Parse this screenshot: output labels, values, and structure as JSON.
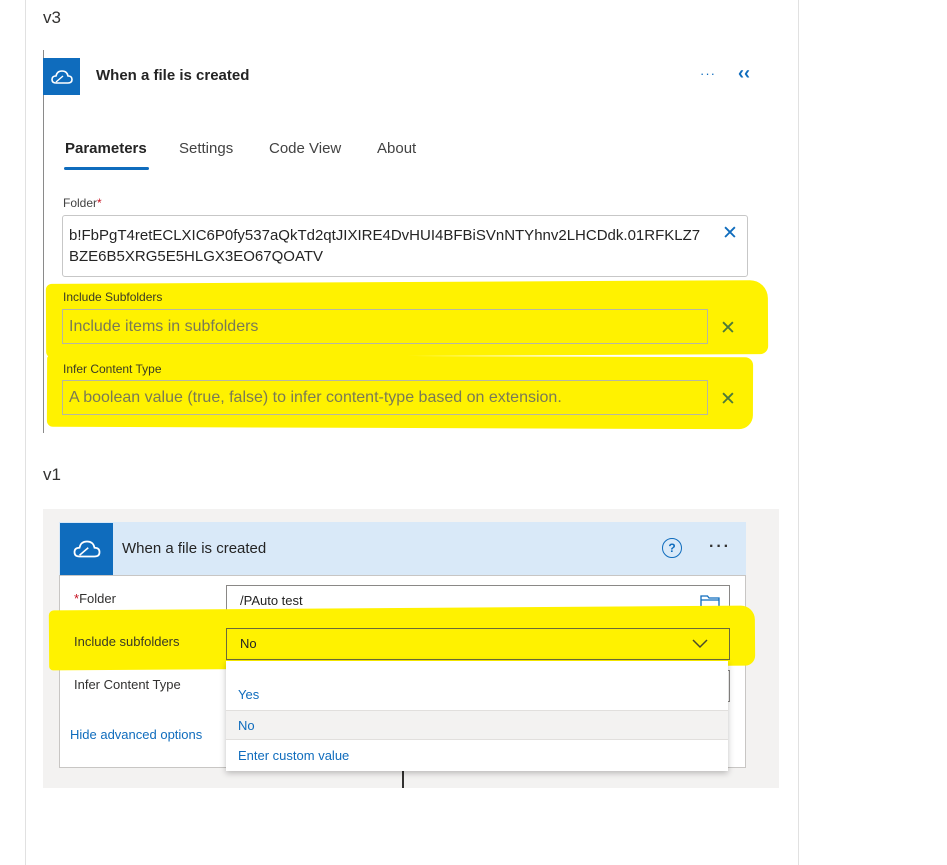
{
  "v3": {
    "section_label": "v3",
    "header": {
      "title": "When a file is created",
      "more": "···",
      "collapse": "‹‹",
      "icon": "cloud-icon"
    },
    "tabs": [
      "Parameters",
      "Settings",
      "Code View",
      "About"
    ],
    "folder": {
      "label": "Folder",
      "required_mark": "*",
      "value": "b!FbPgT4retECLXIC6P0fy537aQkTd2qtJIXIRE4DvHUI4BFBiSVnNTYhnv2LHCDdk.01RFKLZ7BZE6B5XRG5E5HLGX3EO67QOATV",
      "clear": "✕"
    },
    "include_subfolders": {
      "label": "Include Subfolders",
      "placeholder": "Include items in subfolders",
      "clear": "✕"
    },
    "infer_content_type": {
      "label": "Infer Content Type",
      "placeholder": "A boolean value (true, false) to infer content-type based on extension.",
      "clear": "✕"
    }
  },
  "v1": {
    "section_label": "v1",
    "header": {
      "title": "When a file is created",
      "help": "?",
      "more": "···",
      "icon": "cloud-icon"
    },
    "folder": {
      "label": "Folder",
      "required_mark": "*",
      "value": "/PAuto test"
    },
    "include_subfolders": {
      "label": "Include subfolders",
      "value": "No"
    },
    "infer_content_type": {
      "label": "Infer Content Type"
    },
    "dropdown": [
      "Yes",
      "No",
      "Enter custom value"
    ],
    "hide_advanced": "Hide advanced options"
  },
  "colors": {
    "accent": "#0f6cbd",
    "highlight": "#fff200"
  }
}
